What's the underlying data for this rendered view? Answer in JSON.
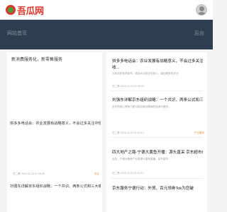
{
  "header": {
    "logo_text": "吾瓜网",
    "logo_icon": "watermelon-icon",
    "avatar_icon": "user-icon"
  },
  "banner": {
    "left_text": "网站首页",
    "right_text": "后台"
  },
  "left": {
    "section_title": "新消费服务化，新零售服务",
    "items": [
      {
        "title": "拼多多电话会：农业发展有战略意义，不会过多关注中短期营收...",
        "meta": "花二蛋  2023-11-29 07:05:09",
        "tag": "农业"
      },
      {
        "title": "刘强东详解京东组织战略：一个共识、两条公式和三大痛点",
        "meta": "",
        "tag": ""
      }
    ]
  },
  "right": {
    "items": [
      {
        "title": "拼多多电话会：农业发展有战略意义，不会过多关注中短期营",
        "title2": "收...",
        "desc": "今年初拼多多宣布，将加大对农业的投入，增加更多的农业",
        "meta": "花二蛋  2023-11-29 07:05:09",
        "tag": ""
      },
      {
        "title": "刘强东详解京东组织战略：一个共识、两条公式和三大痛点",
        "desc": "京东的核心竞争力是以供应链为基础的技术与服务，",
        "meta": "花二蛋  2023-11-22 11:42:12",
        "tag": "产业服务"
      },
      {
        "title": "四大地产之路·宁德大黄鱼开播：源头直采 京东超市价格低于...",
        "desc": "近日，宁德大黄鱼产业带源头直采直播，京东超市...",
        "meta": "花二蛋  2023-11-22 11:42:12",
        "tag": ""
      },
      {
        "title": "京东服务宁德行动：外贸、百元领券Tok为您破",
        "desc": "",
        "meta": "",
        "tag": ""
      }
    ]
  },
  "colors": {
    "brand": "#d9382c",
    "banner_bg": "#2e3d4f",
    "tag": "#e0913a"
  }
}
